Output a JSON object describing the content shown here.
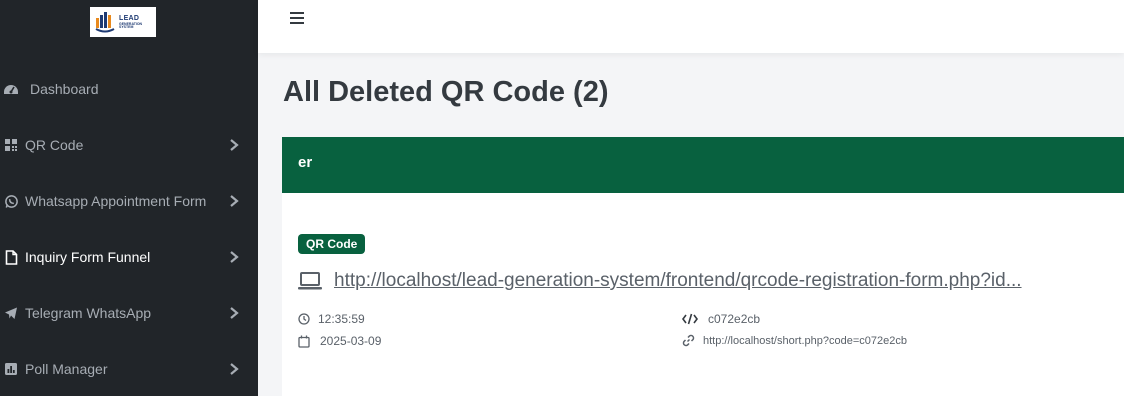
{
  "sidebar": {
    "logo": {
      "line1": "LEAD",
      "line2": "GENERATION",
      "line3": "SYSTEM"
    },
    "items": [
      {
        "label": "Dashboard",
        "icon": "dashboard-icon",
        "has_chevron": false
      },
      {
        "label": "QR Code",
        "icon": "qr-grid-icon",
        "has_chevron": true
      },
      {
        "label": "Whatsapp Appointment Form",
        "icon": "whatsapp-icon",
        "has_chevron": true
      },
      {
        "label": "Inquiry Form Funnel",
        "icon": "file-icon",
        "has_chevron": true,
        "active": true
      },
      {
        "label": "Telegram WhatsApp",
        "icon": "telegram-icon",
        "has_chevron": true
      },
      {
        "label": "Poll Manager",
        "icon": "poll-chart-icon",
        "has_chevron": true
      }
    ]
  },
  "header": {
    "menu_icon": "hamburger-icon"
  },
  "main": {
    "title": "All Deleted QR Code (2)",
    "card": {
      "header_title": "er",
      "badge": "QR Code",
      "url": "http://localhost/lead-generation-system/frontend/qrcode-registration-form.php?id...",
      "time": "12:35:59",
      "date": "2025-03-09",
      "code": "c072e2cb",
      "short_url": "http://localhost/short.php?code=c072e2cb"
    }
  },
  "colors": {
    "sidebar_bg": "#212529",
    "accent_green": "#08613f",
    "text_dark": "#343a40",
    "text_muted": "#5a6169"
  }
}
